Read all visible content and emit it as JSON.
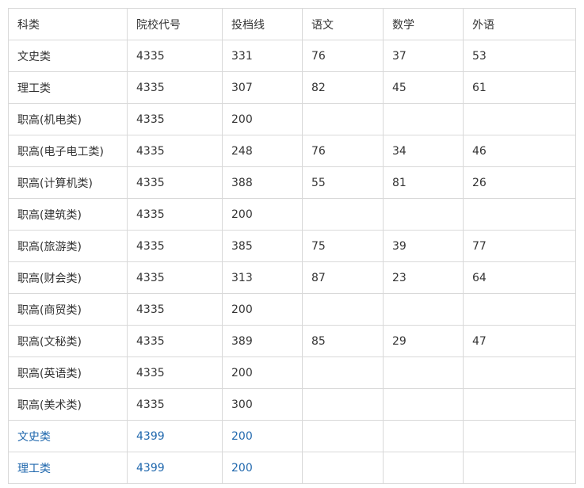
{
  "table": {
    "header": [
      "科类",
      "院校代号",
      "投档线",
      "语文",
      "数学",
      "外语"
    ],
    "rows": [
      [
        "文史类",
        "4335",
        "331",
        "76",
        "37",
        "53"
      ],
      [
        "理工类",
        "4335",
        "307",
        "82",
        "45",
        "61"
      ],
      [
        "职高(机电类)",
        "4335",
        "200",
        "",
        "",
        ""
      ],
      [
        "职高(电子电工类)",
        "4335",
        "248",
        "76",
        "34",
        "46"
      ],
      [
        "职高(计算机类)",
        "4335",
        "388",
        "55",
        "81",
        "26"
      ],
      [
        "职高(建筑类)",
        "4335",
        "200",
        "",
        "",
        ""
      ],
      [
        "职高(旅游类)",
        "4335",
        "385",
        "75",
        "39",
        "77"
      ],
      [
        "职高(财会类)",
        "4335",
        "313",
        "87",
        "23",
        "64"
      ],
      [
        "职高(商贸类)",
        "4335",
        "200",
        "",
        "",
        ""
      ],
      [
        "职高(文秘类)",
        "4335",
        "389",
        "85",
        "29",
        "47"
      ],
      [
        "职高(英语类)",
        "4335",
        "200",
        "",
        "",
        ""
      ],
      [
        "职高(美术类)",
        "4335",
        "300",
        "",
        "",
        ""
      ],
      [
        "文史类",
        "4399",
        "200",
        "",
        "",
        ""
      ],
      [
        "理工类",
        "4399",
        "200",
        "",
        "",
        ""
      ]
    ],
    "link_color": "#1f67ad"
  }
}
